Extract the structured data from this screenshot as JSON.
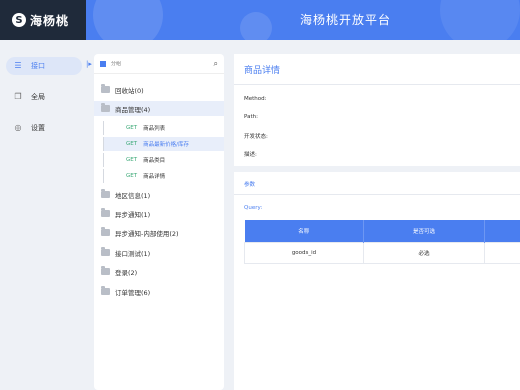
{
  "header": {
    "brand_text": "海杨桃",
    "platform_title": "海杨桃开放平台"
  },
  "nav": {
    "items": [
      {
        "label": "接口",
        "icon": "sliders-icon",
        "active": true
      },
      {
        "label": "全局",
        "icon": "copy-icon",
        "active": false
      },
      {
        "label": "设置",
        "icon": "gear-icon",
        "active": false
      }
    ],
    "collapse_glyph": "|▸"
  },
  "category": {
    "search_placeholder": "分组",
    "folders": [
      {
        "label": "回收站(0)"
      },
      {
        "label": "商品管理(4)"
      },
      {
        "label": "地区信息(1)"
      },
      {
        "label": "异步通知(1)"
      },
      {
        "label": "异步通知-内部使用(2)"
      },
      {
        "label": "接口测试(1)"
      },
      {
        "label": "登录(2)"
      },
      {
        "label": "订单管理(6)"
      }
    ],
    "apis": [
      {
        "method": "GET",
        "label": "商品列表"
      },
      {
        "method": "GET",
        "label": "商品最新价格/库存"
      },
      {
        "method": "GET",
        "label": "商品类目"
      },
      {
        "method": "GET",
        "label": "商品详情"
      }
    ]
  },
  "detail": {
    "title": "商品详情",
    "fields": {
      "method": "Method:",
      "path": "Path:",
      "dev_status": "开发状态:",
      "description": "描述:"
    },
    "params_title": "参数",
    "query_label": "Query:",
    "table": {
      "headers": [
        "名称",
        "是否可选",
        ""
      ],
      "rows": [
        [
          "goods_id",
          "必选",
          ""
        ]
      ]
    }
  },
  "colors": {
    "accent": "#4a7ef0",
    "brand_bg": "#1f2a3a",
    "get_method": "#3aa876"
  }
}
